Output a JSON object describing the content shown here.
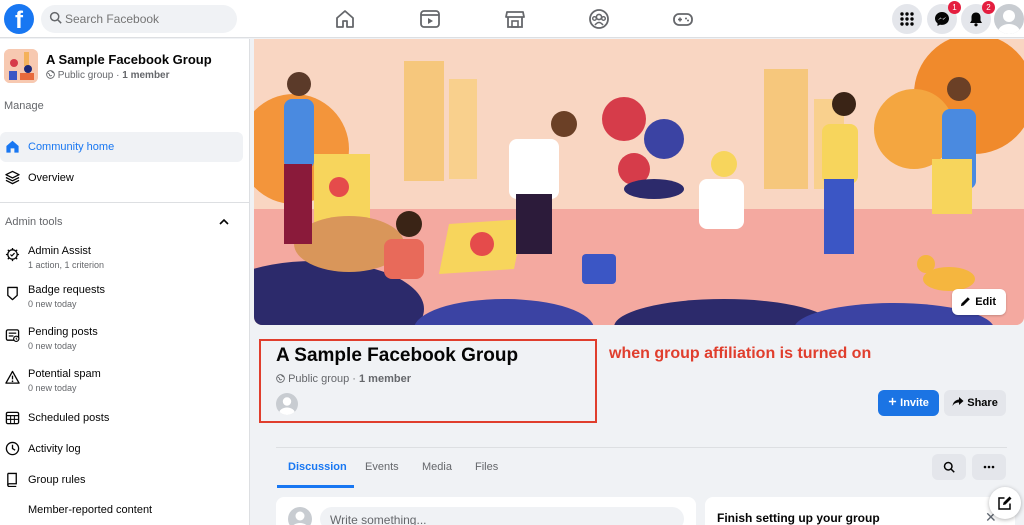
{
  "topbar": {
    "logo": "f",
    "search_placeholder": "Search Facebook",
    "nav_icons": [
      "home-icon",
      "watch-icon",
      "marketplace-icon",
      "groups-icon",
      "gaming-icon"
    ],
    "messenger_badge": "1",
    "notifications_badge": "2"
  },
  "sidebar": {
    "group_name": "A Sample Facebook Group",
    "group_privacy": "Public group",
    "group_members": "1 member",
    "manage_label": "Manage",
    "primary_items": [
      {
        "label": "Community home",
        "icon": "home-icon",
        "active": true
      },
      {
        "label": "Overview",
        "icon": "layers-icon",
        "active": false
      }
    ],
    "admin_tools_label": "Admin tools",
    "admin_items": [
      {
        "label": "Admin Assist",
        "sub": "1 action, 1 criterion"
      },
      {
        "label": "Badge requests",
        "sub": "0 new today"
      },
      {
        "label": "Pending posts",
        "sub": "0 new today"
      },
      {
        "label": "Potential spam",
        "sub": "0 new today"
      },
      {
        "label": "Scheduled posts"
      },
      {
        "label": "Activity log"
      },
      {
        "label": "Group rules"
      },
      {
        "label": "Member-reported content"
      }
    ]
  },
  "main": {
    "edit_label": "Edit",
    "group_title": "A Sample Facebook Group",
    "group_privacy": "Public group",
    "separator": " · ",
    "group_members": "1 member",
    "annotation": "when group affiliation is turned on",
    "invite_label": "Invite",
    "share_label": "Share",
    "tabs": [
      "Discussion",
      "Events",
      "Media",
      "Files"
    ],
    "composer_placeholder": "Write something...",
    "setup_title": "Finish setting up your group",
    "close_glyph": "✕"
  },
  "colors": {
    "brand": "#1877f2",
    "annotation": "#e03e2d",
    "notification_badge": "#e41e3f"
  }
}
